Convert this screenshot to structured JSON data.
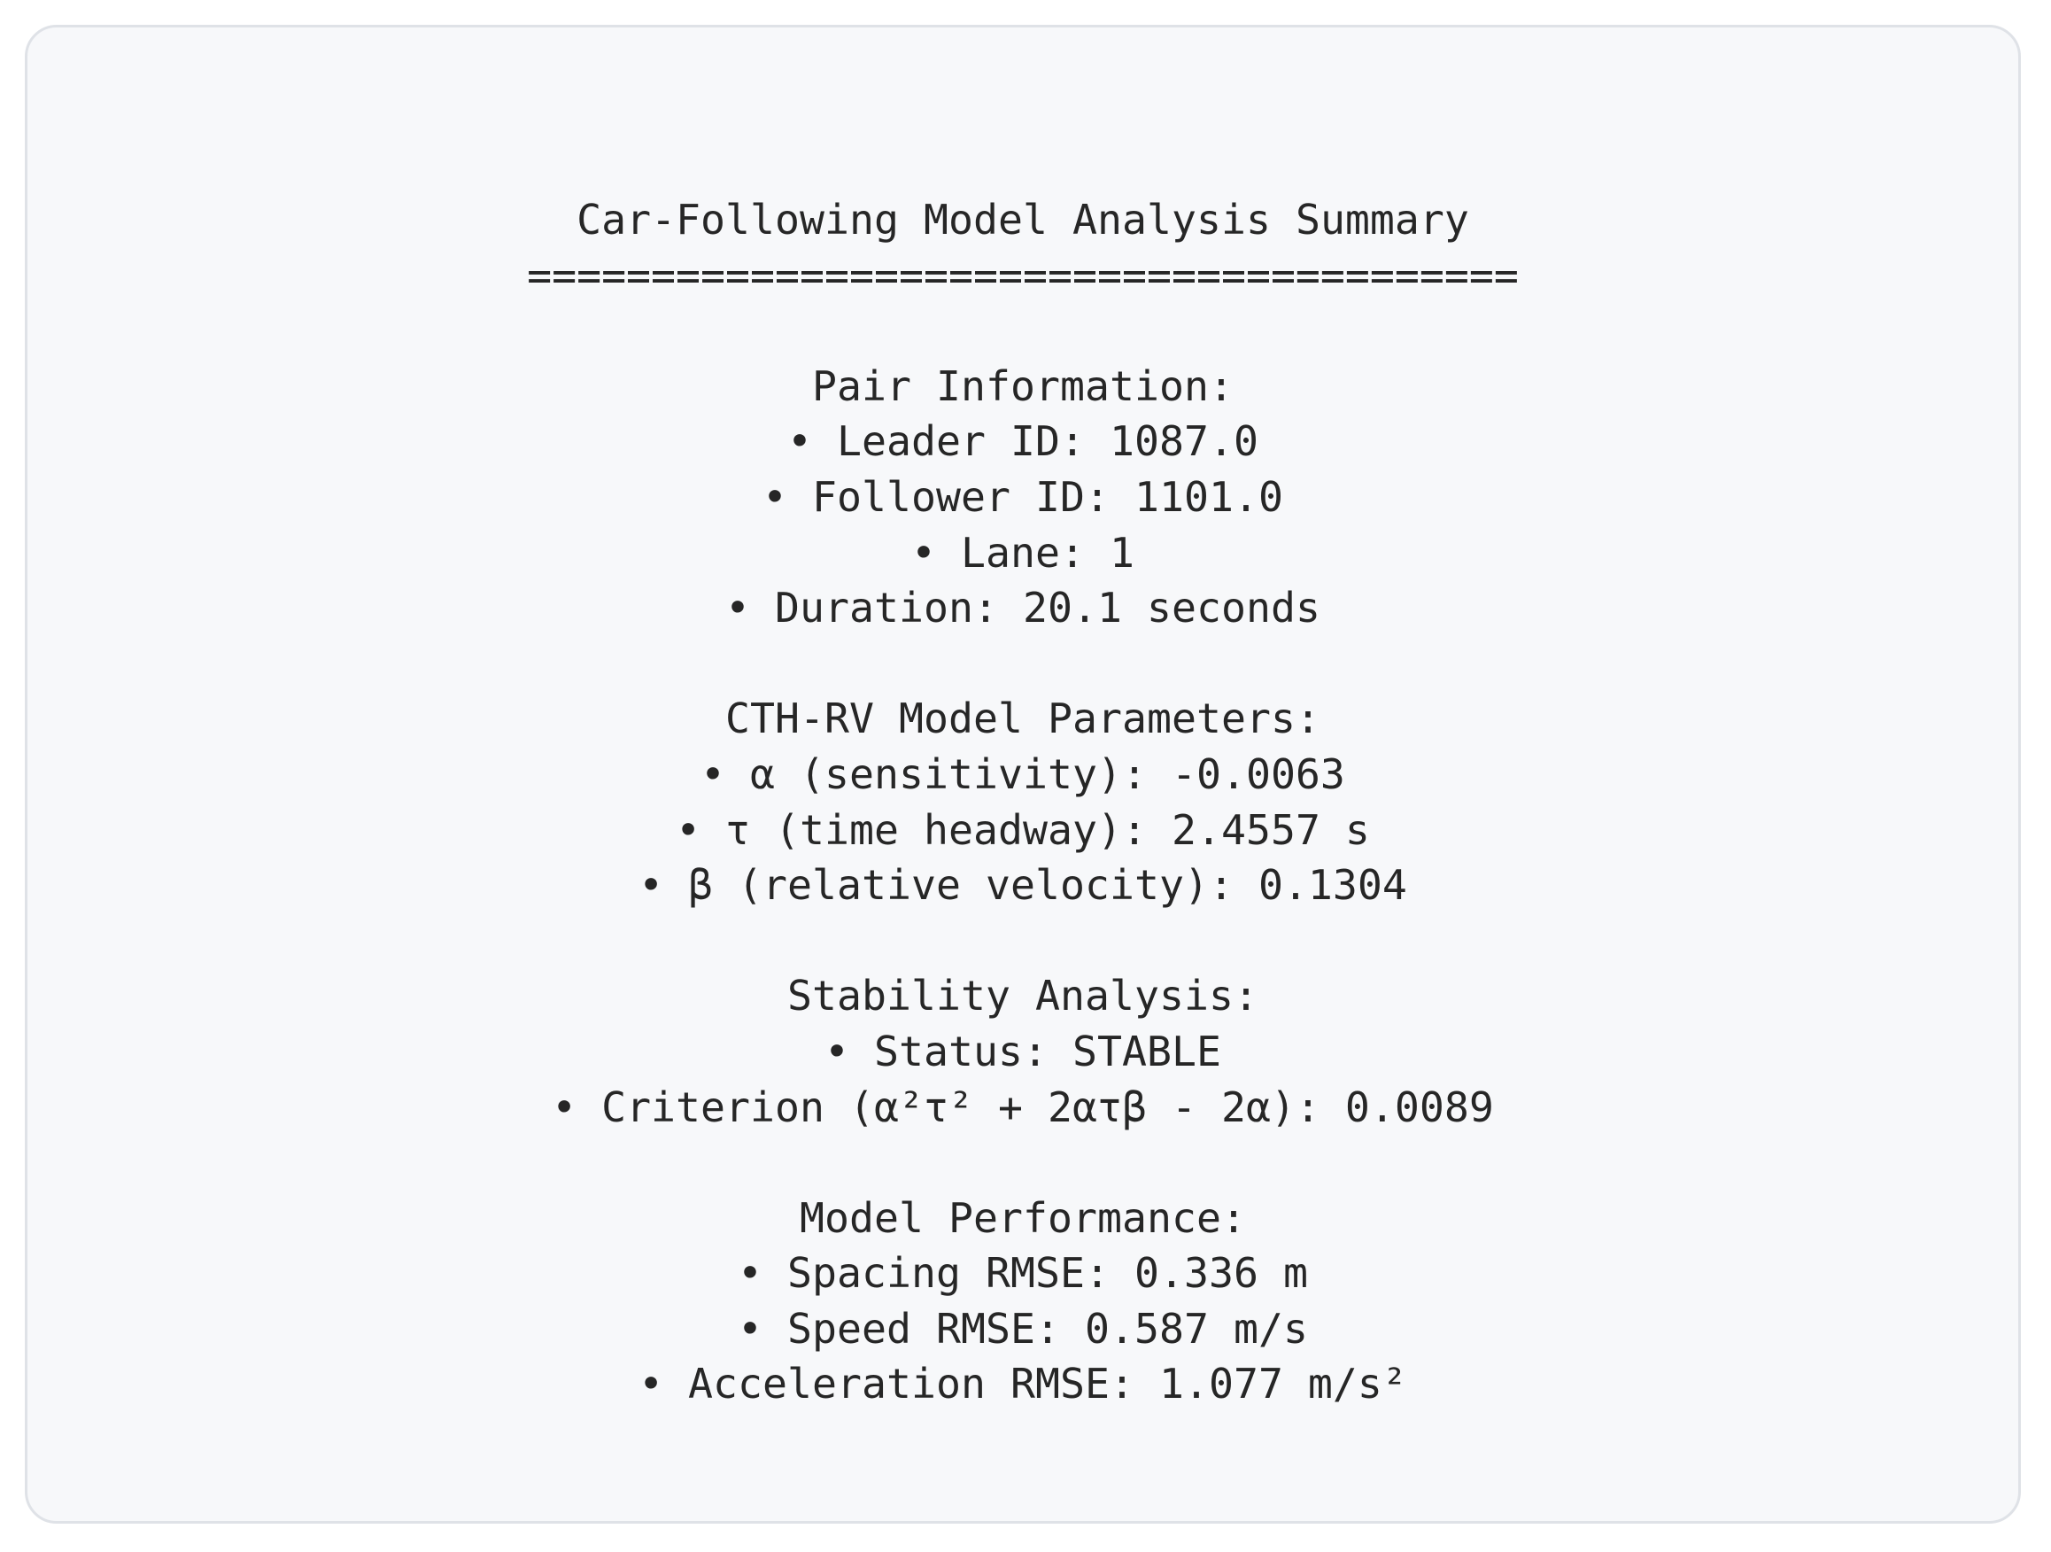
{
  "title": "Car-Following Model Analysis Summary",
  "separator": "========================================",
  "sections": [
    {
      "heading": "Pair Information:",
      "items": [
        "• Leader ID: 1087.0",
        "• Follower ID: 1101.0",
        "• Lane: 1",
        "• Duration: 20.1 seconds"
      ]
    },
    {
      "heading": "CTH-RV Model Parameters:",
      "items": [
        "• α (sensitivity): -0.0063",
        "• τ (time headway): 2.4557 s",
        "• β (relative velocity): 0.1304"
      ]
    },
    {
      "heading": "Stability Analysis:",
      "items": [
        "• Status: STABLE",
        "• Criterion (α²τ² + 2ατβ - 2α): 0.0089"
      ]
    },
    {
      "heading": "Model Performance:",
      "items": [
        "• Spacing RMSE: 0.336 m",
        "• Speed RMSE: 0.587 m/s",
        "• Acceleration RMSE: 1.077 m/s²"
      ]
    }
  ]
}
